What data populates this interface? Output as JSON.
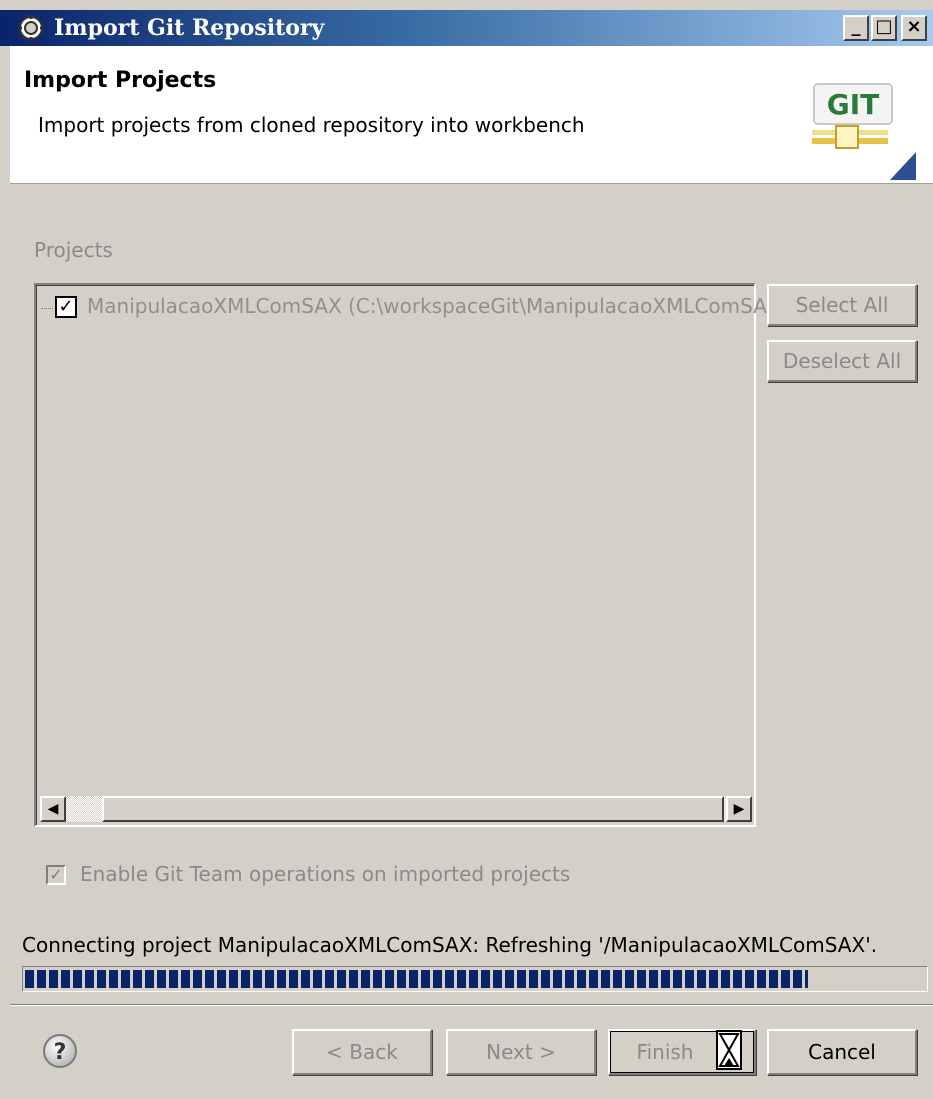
{
  "window": {
    "title": "Import Git Repository",
    "controls": {
      "minimize": "_",
      "maximize": "□",
      "close": "×"
    }
  },
  "banner": {
    "title": "Import Projects",
    "description": "Import projects from cloned repository into workbench",
    "logo_text": "GIT"
  },
  "projects": {
    "label": "Projects",
    "items": [
      {
        "label": "ManipulacaoXMLComSAX (C:\\workspaceGit\\ManipulacaoXMLComSAX)",
        "checked": true
      }
    ],
    "select_all": "Select All",
    "deselect_all": "Deselect All"
  },
  "team_ops": {
    "label": "Enable Git Team operations on imported projects",
    "checked": true,
    "enabled": false
  },
  "progress": {
    "status": "Connecting project ManipulacaoXMLComSAX: Refreshing '/ManipulacaoXMLComSAX'.",
    "fraction": 0.87,
    "color": "#0a246a"
  },
  "footer": {
    "help_icon": "help-question-icon",
    "back": "< Back",
    "next": "Next >",
    "finish": "Finish",
    "cancel": "Cancel",
    "busy_cursor": "hourglass-icon"
  }
}
